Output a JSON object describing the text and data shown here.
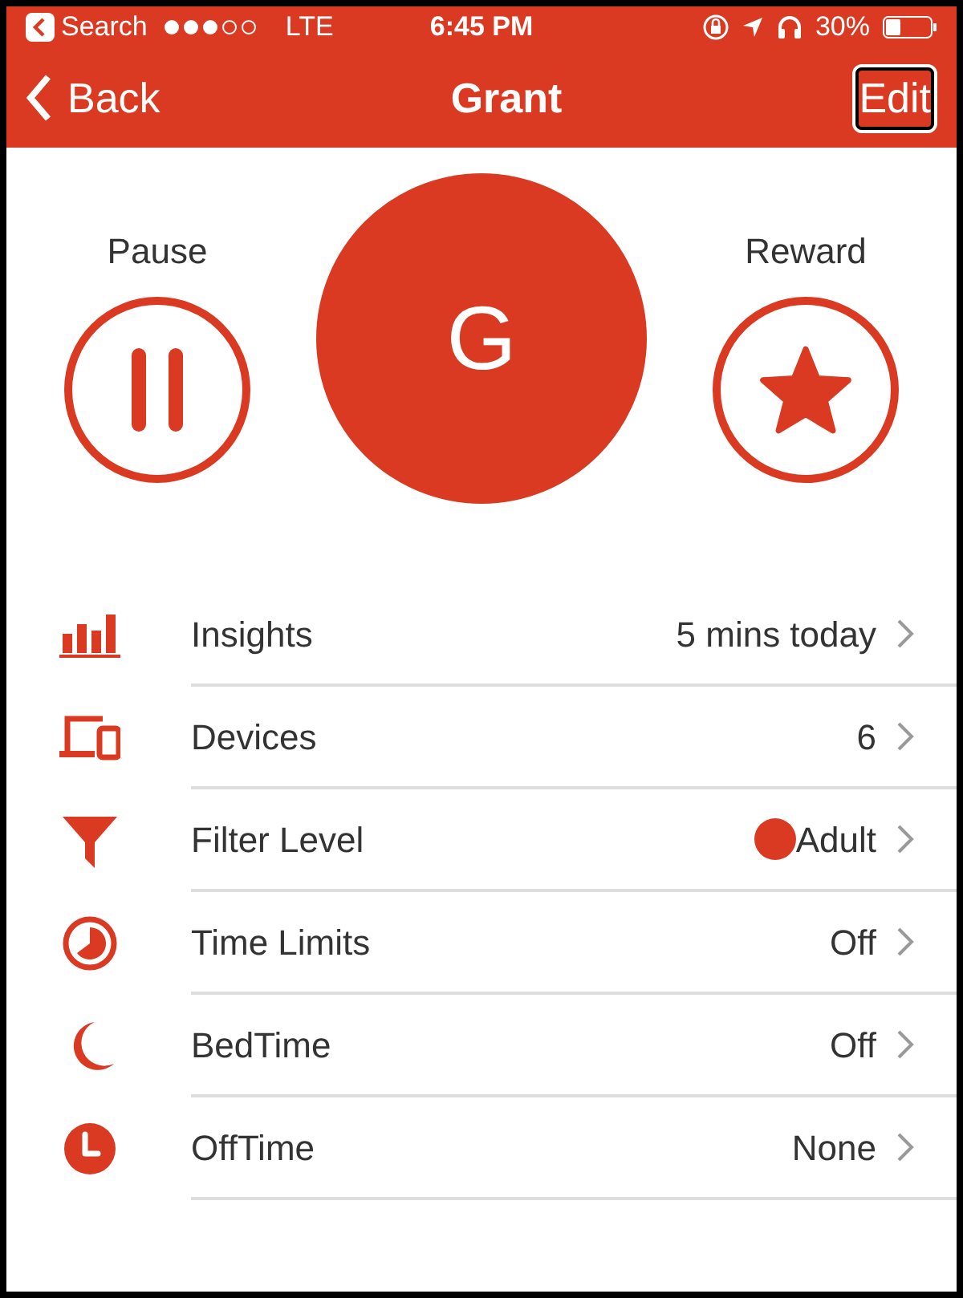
{
  "status_bar": {
    "back_app": "Search",
    "carrier": "LTE",
    "time": "6:45 PM",
    "battery": "30%"
  },
  "nav": {
    "back": "Back",
    "title": "Grant",
    "edit": "Edit"
  },
  "actions": {
    "pause": "Pause",
    "avatar": "G",
    "reward": "Reward"
  },
  "rows": [
    {
      "kind": "insights",
      "label": "Insights",
      "value": "5 mins today"
    },
    {
      "kind": "devices",
      "label": "Devices",
      "value": "6"
    },
    {
      "kind": "filter",
      "label": "Filter Level",
      "value": "Adult",
      "color": "#db3a22"
    },
    {
      "kind": "timelimits",
      "label": "Time Limits",
      "value": "Off"
    },
    {
      "kind": "bedtime",
      "label": "BedTime",
      "value": "Off"
    },
    {
      "kind": "offtime",
      "label": "OffTime",
      "value": "None"
    }
  ]
}
